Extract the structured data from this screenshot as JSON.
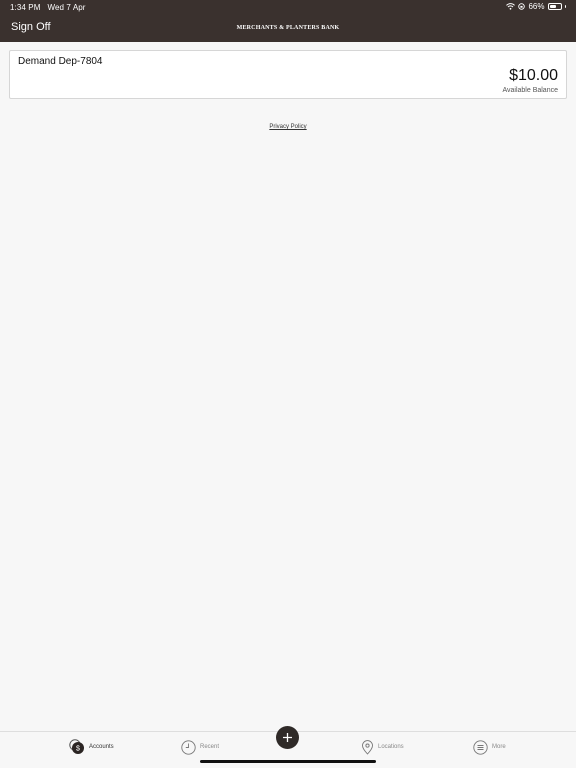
{
  "status_bar": {
    "time": "1:34 PM",
    "date": "Wed 7 Apr",
    "battery": "66%",
    "battery_level": 0.66
  },
  "header": {
    "sign_off": "Sign Off",
    "title": "MERCHANTS & PLANTERS BANK"
  },
  "accounts": [
    {
      "name": "Demand Dep-7804",
      "balance": "$10.00",
      "balance_label": "Available Balance"
    }
  ],
  "privacy_policy": "Privacy Policy",
  "tabbar": {
    "items": [
      {
        "label": "Accounts",
        "icon": "accounts-icon",
        "active": true
      },
      {
        "label": "Recent",
        "icon": "clock-icon",
        "active": false
      },
      {
        "label": "Locations",
        "icon": "location-pin-icon",
        "active": false
      },
      {
        "label": "More",
        "icon": "menu-lines-icon",
        "active": false
      }
    ],
    "fab_icon": "plus-icon"
  },
  "colors": {
    "header_bg": "#3a312e",
    "background": "#f7f7f7",
    "fab_bg": "#2f2a28"
  }
}
